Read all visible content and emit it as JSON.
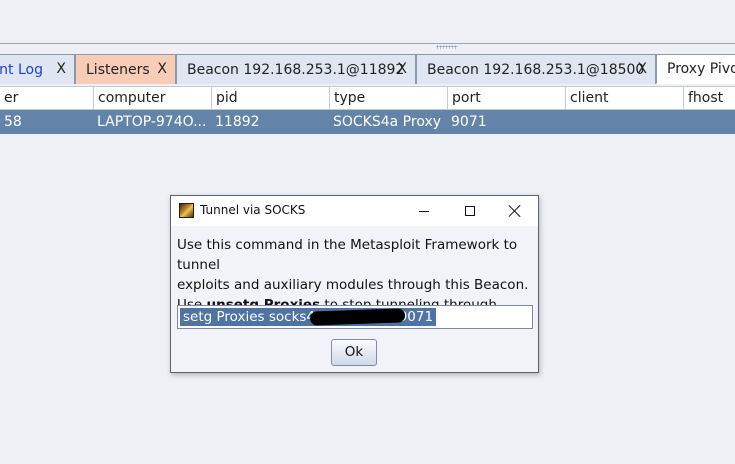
{
  "tabs": [
    {
      "label": "ent Log",
      "close": "X"
    },
    {
      "label": "Listeners",
      "close": "X"
    },
    {
      "label": "Beacon 192.168.253.1@11892",
      "close": "X"
    },
    {
      "label": "Beacon 192.168.253.1@18500",
      "close": "X"
    },
    {
      "label": "Proxy Pivots"
    }
  ],
  "table": {
    "columns": [
      "er",
      "computer",
      "pid",
      "type",
      "port",
      "client",
      "fhost"
    ],
    "rows": [
      [
        "58",
        "LAPTOP-974O...",
        "11892",
        "SOCKS4a Proxy",
        "9071",
        "",
        ""
      ]
    ]
  },
  "dialog": {
    "title": "Tunnel via SOCKS",
    "line1": "Use this command in the Metasploit Framework to tunnel",
    "line2": "exploits and auxiliary modules through this Beacon.",
    "line3_pre": "Use ",
    "line3_bold": "unsetg Proxies",
    "line3_post": " to stop tunneling through Beacon.",
    "command_pre": "setg Proxies socks4:",
    "command_post": "3:9071",
    "ok_label": "Ok"
  },
  "icons": {
    "app": "cobalt-strike-icon",
    "minimize": "minimize-icon",
    "maximize": "maximize-icon",
    "close": "close-icon"
  }
}
